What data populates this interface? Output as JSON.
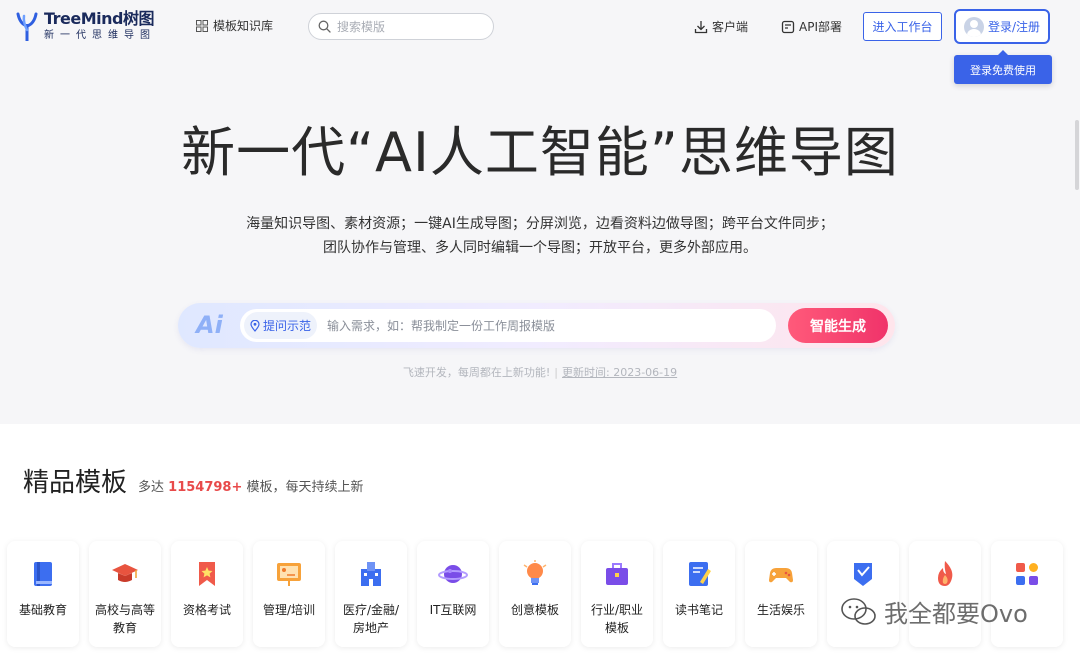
{
  "header": {
    "logo_title": "TreeMind树图",
    "logo_subtitle": "新一代思维导图",
    "template_library": "模板知识库",
    "search_placeholder": "搜索模版",
    "client": "客户端",
    "api": "API部署",
    "workspace": "进入工作台",
    "login": "登录/注册",
    "login_tooltip": "登录免费使用"
  },
  "hero": {
    "title": "新一代“AI人工智能”思维导图",
    "desc_line1": "海量知识导图、素材资源；一键AI生成导图；分屏浏览，边看资料边做导图；跨平台文件同步；",
    "desc_line2": "团队协作与管理、多人同时编辑一个导图；开放平台，更多外部应用。"
  },
  "ai_bar": {
    "logo": "Ai",
    "example": "提问示范",
    "input_placeholder": "输入需求，如：帮我制定一份工作周报模版",
    "generate": "智能生成"
  },
  "update": {
    "text": "飞速开发，每周都在上新功能!",
    "time": "更新时间: 2023-06-19"
  },
  "templates": {
    "title": "精品模板",
    "sub_prefix": "多达",
    "count": "1154798+",
    "sub_suffix": "模板，每天持续上新",
    "categories": [
      {
        "label": "基础教育",
        "icon": "book-icon"
      },
      {
        "label": "高校与高等教育",
        "icon": "graduation-cap-icon"
      },
      {
        "label": "资格考试",
        "icon": "bookmark-star-icon"
      },
      {
        "label": "管理/培训",
        "icon": "presentation-board-icon"
      },
      {
        "label": "医疗/金融/房地产",
        "icon": "building-icon"
      },
      {
        "label": "IT互联网",
        "icon": "planet-icon"
      },
      {
        "label": "创意模板",
        "icon": "lightbulb-icon"
      },
      {
        "label": "行业/职业模板",
        "icon": "briefcase-icon"
      },
      {
        "label": "读书笔记",
        "icon": "notebook-pen-icon"
      },
      {
        "label": "生活娱乐",
        "icon": "gamepad-icon"
      },
      {
        "label": "",
        "icon": "badge-icon"
      },
      {
        "label": "",
        "icon": "flame-icon"
      },
      {
        "label": "",
        "icon": "grid-apps-icon"
      }
    ]
  },
  "watermark": "我全都要Ovo",
  "colors": {
    "accent": "#3a63e8",
    "generate": "#f0336a",
    "count": "#e84a4a"
  }
}
